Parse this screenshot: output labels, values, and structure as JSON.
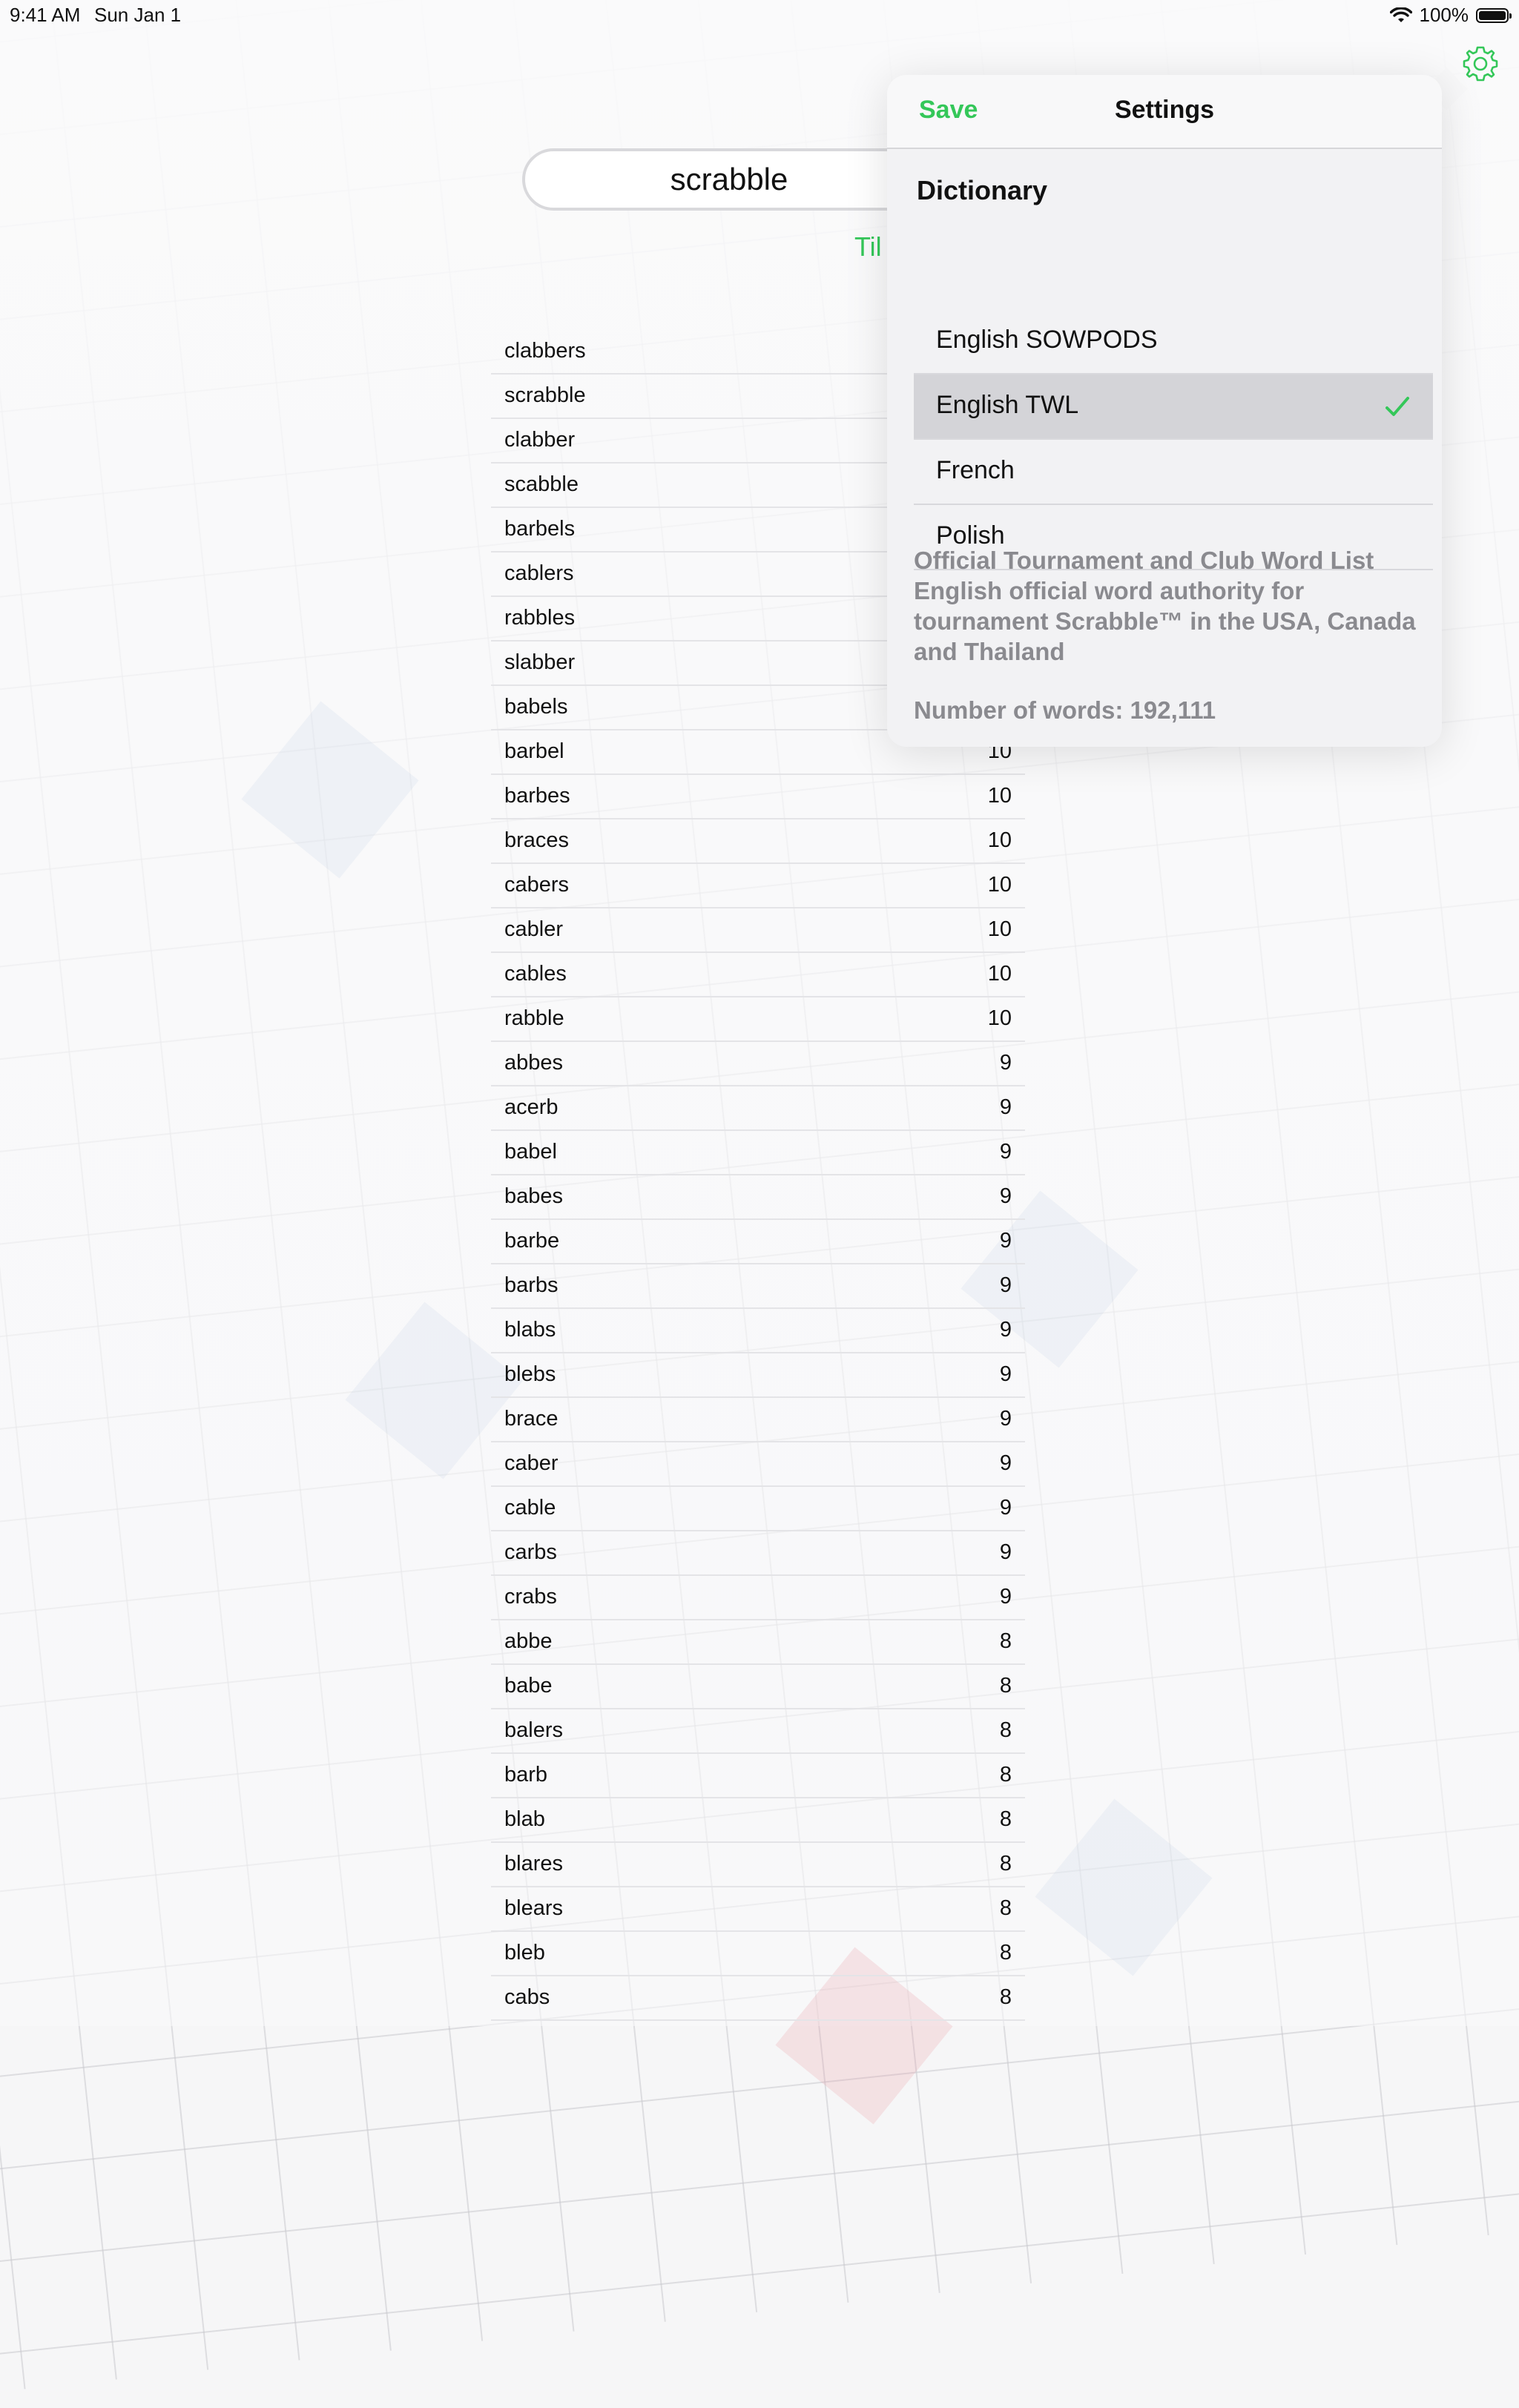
{
  "status_bar": {
    "time": "9:41 AM",
    "date": "Sun Jan 1",
    "battery": "100%",
    "icons": [
      "wifi-icon",
      "battery-icon"
    ]
  },
  "search": {
    "value": "scrabble"
  },
  "tiles_link_label": "Til",
  "words": [
    {
      "word": "clabbers",
      "score": ""
    },
    {
      "word": "scrabble",
      "score": ""
    },
    {
      "word": "clabber",
      "score": ""
    },
    {
      "word": "scabble",
      "score": ""
    },
    {
      "word": "barbels",
      "score": ""
    },
    {
      "word": "cablers",
      "score": ""
    },
    {
      "word": "rabbles",
      "score": ""
    },
    {
      "word": "slabber",
      "score": ""
    },
    {
      "word": "babels",
      "score": ""
    },
    {
      "word": "barbel",
      "score": "10"
    },
    {
      "word": "barbes",
      "score": "10"
    },
    {
      "word": "braces",
      "score": "10"
    },
    {
      "word": "cabers",
      "score": "10"
    },
    {
      "word": "cabler",
      "score": "10"
    },
    {
      "word": "cables",
      "score": "10"
    },
    {
      "word": "rabble",
      "score": "10"
    },
    {
      "word": "abbes",
      "score": "9"
    },
    {
      "word": "acerb",
      "score": "9"
    },
    {
      "word": "babel",
      "score": "9"
    },
    {
      "word": "babes",
      "score": "9"
    },
    {
      "word": "barbe",
      "score": "9"
    },
    {
      "word": "barbs",
      "score": "9"
    },
    {
      "word": "blabs",
      "score": "9"
    },
    {
      "word": "blebs",
      "score": "9"
    },
    {
      "word": "brace",
      "score": "9"
    },
    {
      "word": "caber",
      "score": "9"
    },
    {
      "word": "cable",
      "score": "9"
    },
    {
      "word": "carbs",
      "score": "9"
    },
    {
      "word": "crabs",
      "score": "9"
    },
    {
      "word": "abbe",
      "score": "8"
    },
    {
      "word": "babe",
      "score": "8"
    },
    {
      "word": "balers",
      "score": "8"
    },
    {
      "word": "barb",
      "score": "8"
    },
    {
      "word": "blab",
      "score": "8"
    },
    {
      "word": "blares",
      "score": "8"
    },
    {
      "word": "blears",
      "score": "8"
    },
    {
      "word": "bleb",
      "score": "8"
    },
    {
      "word": "cabs",
      "score": "8"
    }
  ],
  "settings": {
    "save_label": "Save",
    "title": "Settings",
    "section_header": "Dictionary",
    "options": [
      {
        "label": "English SOWPODS",
        "selected": false
      },
      {
        "label": "English TWL",
        "selected": true
      },
      {
        "label": "French",
        "selected": false
      },
      {
        "label": "Polish",
        "selected": false
      }
    ],
    "description": "Official Tournament and Club Word List\nEnglish official word authority for\ntournament Scrabble™ in the USA, Canada\nand Thailand",
    "word_count": "Number of words: 192,111"
  },
  "colors": {
    "accent": "#34c759",
    "selected_row": "#d4d4d8",
    "secondary_text": "#8a8a8f"
  }
}
